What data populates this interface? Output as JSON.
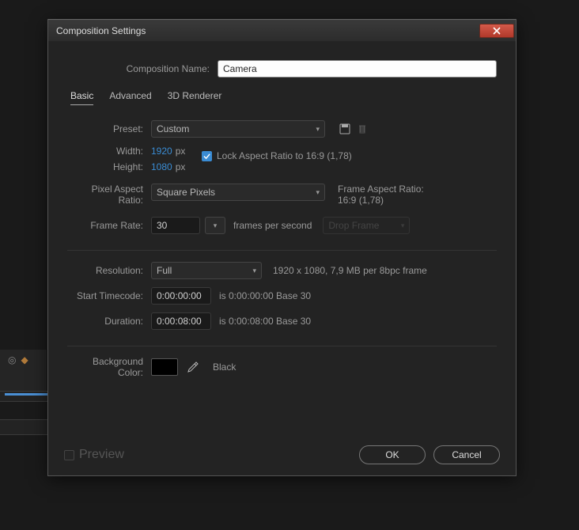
{
  "dialog": {
    "title": "Composition Settings",
    "close_icon": "close-x"
  },
  "composition_name": {
    "label": "Composition Name:",
    "value": "Camera"
  },
  "tabs": [
    "Basic",
    "Advanced",
    "3D Renderer"
  ],
  "active_tab": 0,
  "preset": {
    "label": "Preset:",
    "value": "Custom"
  },
  "dimensions": {
    "width_label": "Width:",
    "width_value": "1920",
    "height_label": "Height:",
    "height_value": "1080",
    "unit": "px",
    "lock_label": "Lock Aspect Ratio to 16:9 (1,78)",
    "lock_checked": true
  },
  "pixel_aspect": {
    "label": "Pixel Aspect Ratio:",
    "value": "Square Pixels",
    "frame_aspect_label": "Frame Aspect Ratio:",
    "frame_aspect_value": "16:9 (1,78)"
  },
  "frame_rate": {
    "label": "Frame Rate:",
    "value": "30",
    "suffix": "frames per second",
    "drop_value": "Drop Frame"
  },
  "resolution": {
    "label": "Resolution:",
    "value": "Full",
    "hint": "1920 x 1080, 7,9 MB per 8bpc frame"
  },
  "start_timecode": {
    "label": "Start Timecode:",
    "value": "0:00:00:00",
    "hint": "is 0:00:00:00  Base 30"
  },
  "duration": {
    "label": "Duration:",
    "value": "0:00:08:00",
    "hint": "is 0:00:08:00  Base 30"
  },
  "bg_color": {
    "label": "Background Color:",
    "name": "Black",
    "hex": "#000000"
  },
  "footer": {
    "preview_label": "Preview",
    "ok": "OK",
    "cancel": "Cancel"
  }
}
